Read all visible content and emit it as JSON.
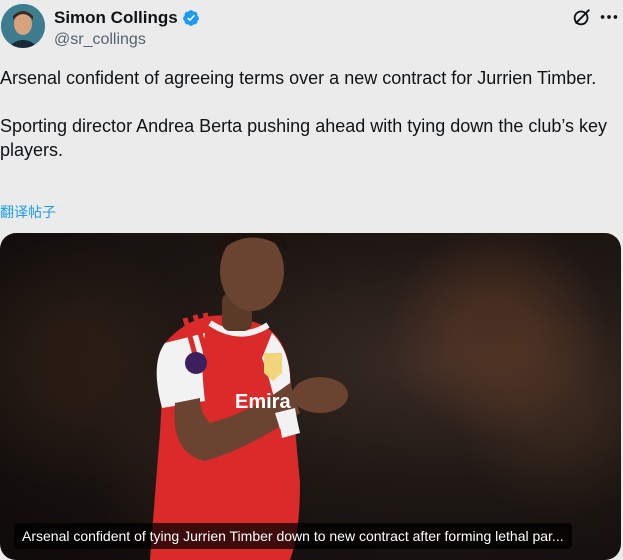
{
  "author": {
    "name": "Simon Collings",
    "handle": "@sr_collings",
    "verified": true
  },
  "tweet": {
    "paragraphs": [
      "Arsenal confident of agreeing terms over a new contract for Jurrien Timber.",
      "Sporting director Andrea Berta pushing ahead with tying down the club’s key players."
    ],
    "translate_label": "翻译帖子"
  },
  "media": {
    "caption": "Arsenal confident of tying Jurrien Timber down to new contract after forming lethal par..."
  },
  "icons": {
    "verified": "verified-badge-icon",
    "grok": "grok-icon",
    "more": "more-options-icon"
  },
  "colors": {
    "background": "#ebebeb",
    "link": "#1d9bf0",
    "verified": "#1d9bf0",
    "jersey_red": "#db2a2a"
  }
}
